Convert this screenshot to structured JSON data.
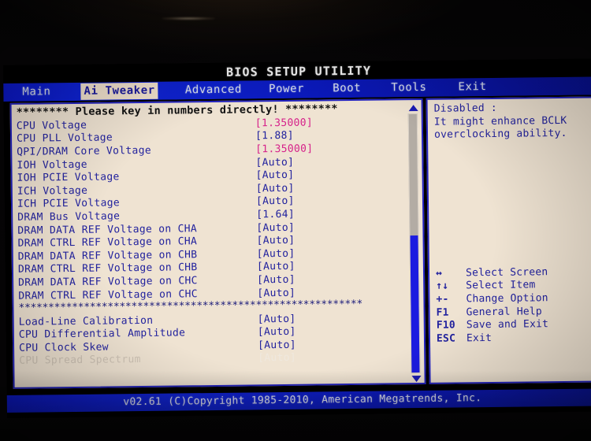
{
  "title": "BIOS SETUP UTILITY",
  "menu": {
    "items": [
      {
        "label": "Main",
        "active": false
      },
      {
        "label": "Ai Tweaker",
        "active": true
      },
      {
        "label": "Advanced",
        "active": false
      },
      {
        "label": "Power",
        "active": false
      },
      {
        "label": "Boot",
        "active": false
      },
      {
        "label": "Tools",
        "active": false
      },
      {
        "label": "Exit",
        "active": false
      }
    ]
  },
  "main": {
    "banner": "******** Please key in numbers directly! ********",
    "separator": "**********************************************************",
    "rows": [
      {
        "label": "CPU Voltage",
        "value": "[1.35000]",
        "highlight": true,
        "dim": false
      },
      {
        "label": "CPU PLL Voltage",
        "value": "[1.88]",
        "highlight": false,
        "dim": false
      },
      {
        "label": "QPI/DRAM Core Voltage",
        "value": "[1.35000]",
        "highlight": true,
        "dim": false
      },
      {
        "label": "IOH Voltage",
        "value": "[Auto]",
        "highlight": false,
        "dim": false
      },
      {
        "label": "IOH PCIE Voltage",
        "value": "[Auto]",
        "highlight": false,
        "dim": false
      },
      {
        "label": "ICH Voltage",
        "value": "[Auto]",
        "highlight": false,
        "dim": false
      },
      {
        "label": "ICH PCIE Voltage",
        "value": "[Auto]",
        "highlight": false,
        "dim": false
      },
      {
        "label": "DRAM Bus Voltage",
        "value": "[1.64]",
        "highlight": false,
        "dim": false
      },
      {
        "label": "DRAM DATA REF Voltage on CHA",
        "value": "[Auto]",
        "highlight": false,
        "dim": false
      },
      {
        "label": "DRAM CTRL REF Voltage on CHA",
        "value": "[Auto]",
        "highlight": false,
        "dim": false
      },
      {
        "label": "DRAM DATA REF Voltage on CHB",
        "value": "[Auto]",
        "highlight": false,
        "dim": false
      },
      {
        "label": "DRAM CTRL REF Voltage on CHB",
        "value": "[Auto]",
        "highlight": false,
        "dim": false
      },
      {
        "label": "DRAM DATA REF Voltage on CHC",
        "value": "[Auto]",
        "highlight": false,
        "dim": false
      },
      {
        "label": "DRAM CTRL REF Voltage on CHC",
        "value": "[Auto]",
        "highlight": false,
        "dim": false
      }
    ],
    "rows_after_separator": [
      {
        "label": "Load-Line Calibration",
        "value": "[Auto]",
        "highlight": false,
        "dim": false
      },
      {
        "label": "CPU Differential Amplitude",
        "value": "[Auto]",
        "highlight": false,
        "dim": false
      },
      {
        "label": "CPU Clock Skew",
        "value": "[Auto]",
        "highlight": false,
        "dim": false
      },
      {
        "label": "CPU Spread Spectrum",
        "value": "[Auto]",
        "highlight": false,
        "dim": true
      }
    ]
  },
  "scrollbar": {
    "up_arrow": "scroll-up-arrow",
    "down_arrow": "scroll-down-arrow",
    "thumb_position": "bottom"
  },
  "help": {
    "lines": [
      "Disabled :",
      "It might enhance BCLK",
      "overclocking ability."
    ]
  },
  "legend": {
    "rows": [
      {
        "key": "↔",
        "desc": "Select Screen"
      },
      {
        "key": "↑↓",
        "desc": "Select Item"
      },
      {
        "key": "+-",
        "desc": "Change Option"
      },
      {
        "key": "F1",
        "desc": "General Help"
      },
      {
        "key": "F10",
        "desc": "Save and Exit"
      },
      {
        "key": "ESC",
        "desc": "Exit"
      }
    ]
  },
  "footer": {
    "text": "v02.61 (C)Copyright 1985-2010, American Megatrends, Inc."
  },
  "colors": {
    "screen_bg": "#efe3d2",
    "text_blue": "#22229e",
    "value_highlight": "#d6218a",
    "bar_blue": "#1226e0",
    "active_tab_bg": "#efe0cc",
    "disabled_text": "#cfc4b6"
  }
}
